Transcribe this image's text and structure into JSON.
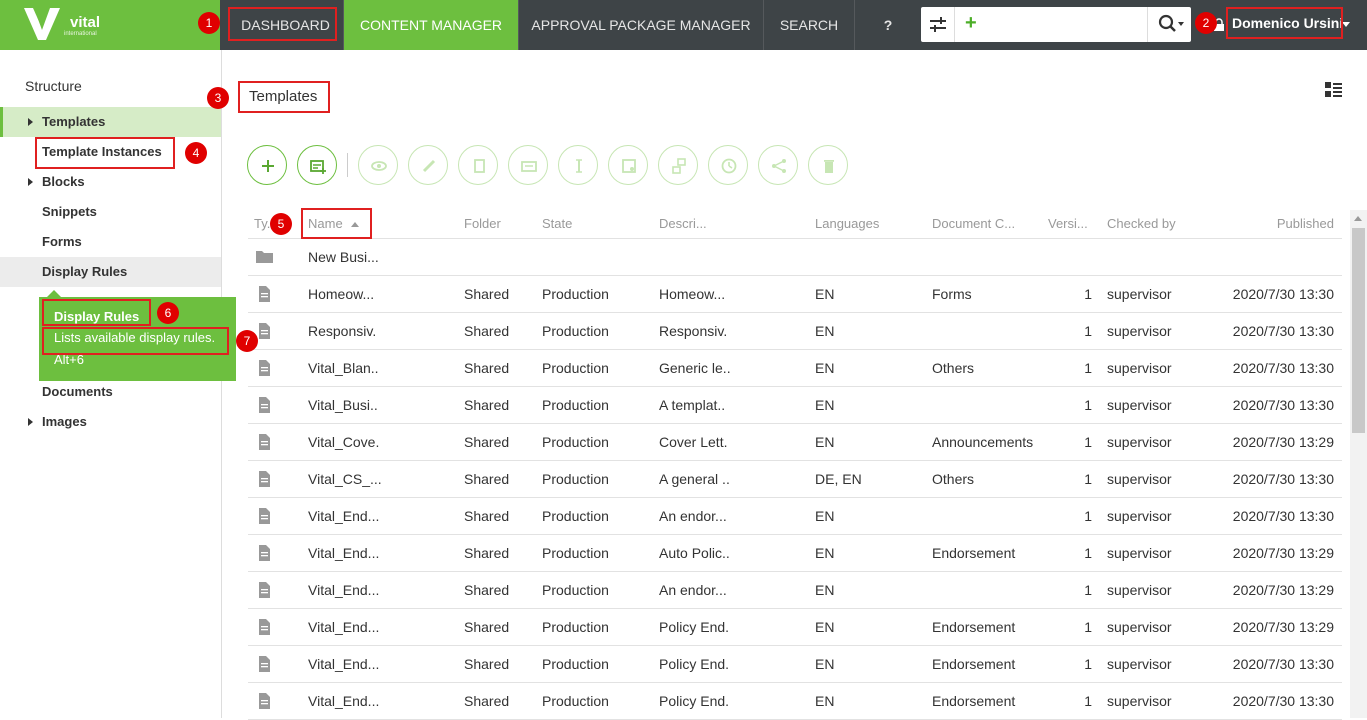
{
  "brand": {
    "name": "vital",
    "sub": "international"
  },
  "nav": {
    "dashboard": "DASHBOARD",
    "content_manager": "CONTENT MANAGER",
    "approval": "APPROVAL PACKAGE MANAGER",
    "search": "SEARCH",
    "help": "?"
  },
  "search": {
    "placeholder": "",
    "add": "+"
  },
  "user": {
    "name": "Domenico Ursini"
  },
  "badges": [
    "1",
    "2",
    "3",
    "4",
    "5",
    "6",
    "7"
  ],
  "sidebar": {
    "title": "Structure",
    "items": [
      "Templates",
      "Template Instances",
      "Blocks",
      "Snippets",
      "Forms",
      "Display Rules",
      "Documents",
      "Images"
    ]
  },
  "tooltip": {
    "title": "Display Rules",
    "desc": "Lists available display rules.",
    "shortcut": "Alt+6"
  },
  "main": {
    "title": "Templates"
  },
  "toolbar": [
    "add-icon",
    "new-instance-icon",
    "preview-icon",
    "edit-icon",
    "copy-icon",
    "duplicate-icon",
    "text-icon",
    "image-icon",
    "move-icon",
    "history-icon",
    "share-icon",
    "delete-icon"
  ],
  "table": {
    "headers": [
      "Ty...",
      "Name",
      "Folder",
      "State",
      "Descri...",
      "Languages",
      "Document C...",
      "Versi...",
      "Checked by",
      "Published"
    ],
    "rows": [
      [
        "folder",
        "New Busi...",
        "",
        "",
        "",
        "",
        "",
        "",
        "",
        ""
      ],
      [
        "doc",
        "Homeow...",
        "Shared",
        "Production",
        "Homeow...",
        "EN",
        "Forms",
        "1",
        "supervisor",
        "2020/7/30 13:30"
      ],
      [
        "doc",
        "Responsiv.",
        "Shared",
        "Production",
        "Responsiv.",
        "EN",
        "",
        "1",
        "supervisor",
        "2020/7/30 13:30"
      ],
      [
        "doc",
        "Vital_Blan..",
        "Shared",
        "Production",
        "Generic le..",
        "EN",
        "Others",
        "1",
        "supervisor",
        "2020/7/30 13:30"
      ],
      [
        "doc",
        "Vital_Busi..",
        "Shared",
        "Production",
        "A templat..",
        "EN",
        "",
        "1",
        "supervisor",
        "2020/7/30 13:30"
      ],
      [
        "doc",
        "Vital_Cove.",
        "Shared",
        "Production",
        "Cover Lett.",
        "EN",
        "Announcements",
        "1",
        "supervisor",
        "2020/7/30 13:29"
      ],
      [
        "doc",
        "Vital_CS_...",
        "Shared",
        "Production",
        "A general ..",
        "DE, EN",
        "Others",
        "1",
        "supervisor",
        "2020/7/30 13:30"
      ],
      [
        "doc",
        "Vital_End...",
        "Shared",
        "Production",
        "An endor...",
        "EN",
        "",
        "1",
        "supervisor",
        "2020/7/30 13:30"
      ],
      [
        "doc",
        "Vital_End...",
        "Shared",
        "Production",
        "Auto Polic..",
        "EN",
        "Endorsement",
        "1",
        "supervisor",
        "2020/7/30 13:29"
      ],
      [
        "doc",
        "Vital_End...",
        "Shared",
        "Production",
        "An endor...",
        "EN",
        "",
        "1",
        "supervisor",
        "2020/7/30 13:29"
      ],
      [
        "doc",
        "Vital_End...",
        "Shared",
        "Production",
        "Policy End.",
        "EN",
        "Endorsement",
        "1",
        "supervisor",
        "2020/7/30 13:29"
      ],
      [
        "doc",
        "Vital_End...",
        "Shared",
        "Production",
        "Policy End.",
        "EN",
        "Endorsement",
        "1",
        "supervisor",
        "2020/7/30 13:30"
      ],
      [
        "doc",
        "Vital_End...",
        "Shared",
        "Production",
        "Policy End.",
        "EN",
        "Endorsement",
        "1",
        "supervisor",
        "2020/7/30 13:30"
      ]
    ]
  },
  "colors": {
    "accent": "#6dbf3f",
    "topbar": "#3e4447",
    "annotation": "#e02020"
  }
}
